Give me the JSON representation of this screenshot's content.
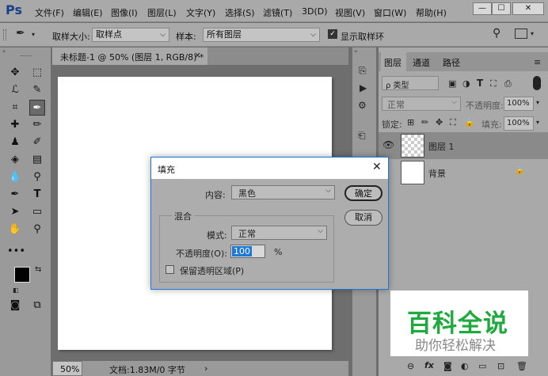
{
  "app": {
    "logo": "Ps"
  },
  "menu": [
    "文件(F)",
    "编辑(E)",
    "图像(I)",
    "图层(L)",
    "文字(Y)",
    "选择(S)",
    "滤镜(T)",
    "3D(D)",
    "视图(V)",
    "窗口(W)",
    "帮助(H)"
  ],
  "window_buttons": {
    "minimize": "—",
    "maximize": "☐",
    "close": "✕"
  },
  "options": {
    "sample_size_label": "取样大小:",
    "sample_size_value": "取样点",
    "sample_label": "样本:",
    "sample_value": "所有图层",
    "show_ring_label": "显示取样环",
    "show_ring_checked": true
  },
  "document": {
    "tab_title": "未标题-1 @ 50% (图层 1, RGB/8) *",
    "tab_close": "×",
    "zoom": "50%",
    "doc_info": "文档:1.83M/0 字节"
  },
  "layers_panel": {
    "tabs": [
      "图层",
      "通道",
      "路径"
    ],
    "filter_kind": "ρ 类型",
    "blend_mode": "正常",
    "opacity_label": "不透明度:",
    "opacity_value": "100%",
    "lock_label": "锁定:",
    "fill_label": "填充:",
    "fill_value": "100%",
    "layers": [
      {
        "name": "图层 1",
        "selected": true,
        "visible": true
      },
      {
        "name": "背景",
        "selected": false,
        "visible": false,
        "locked": true
      }
    ],
    "footer_icons": [
      "link-icon",
      "fx-icon",
      "mask-icon",
      "adjustment-icon",
      "folder-icon",
      "new-layer-icon",
      "trash-icon"
    ]
  },
  "dialog": {
    "title": "填充",
    "close": "✕",
    "content_label": "内容:",
    "content_value": "黑色",
    "ok": "确定",
    "cancel": "取消",
    "blend_group": "混合",
    "mode_label": "模式:",
    "mode_value": "正常",
    "opacity_label": "不透明度(O):",
    "opacity_value": "100",
    "opacity_unit": "%",
    "preserve_label": "保留透明区域(P)",
    "preserve_checked": false
  },
  "watermark": {
    "title": "百科全说",
    "subtitle": "助你轻松解决"
  },
  "colors": {
    "accent_blue": "#1e78d8",
    "watermark_green": "#1faa3e",
    "ps_blue": "#1a3f8a"
  }
}
